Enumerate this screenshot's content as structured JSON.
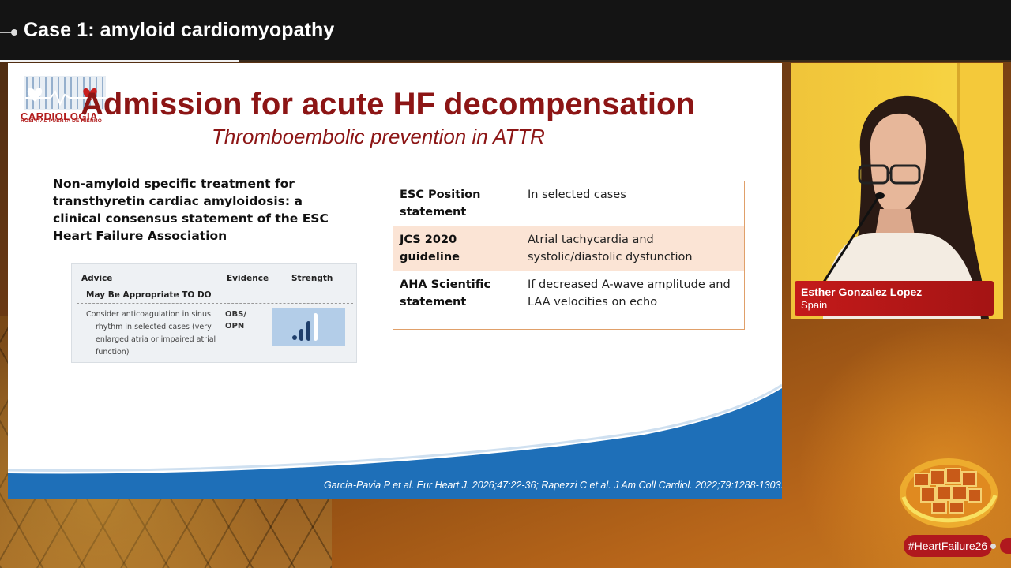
{
  "header": {
    "title": "Case 1: amyloid cardiomyopathy"
  },
  "slide": {
    "logo_text": "CARDIOLOGIA",
    "logo_subtext": "HOSPITAL PUERTA DE HIERRO",
    "title": "Admission for acute HF decompensation",
    "subtitle": "Thromboembolic prevention in ATTR",
    "consensus_heading": "Non-amyloid specific treatment for transthyretin cardiac amyloidosis: a clinical consensus statement of the ESC Heart Failure Association",
    "advice_table": {
      "col_advice": "Advice",
      "col_evidence": "Evidence",
      "col_strength": "Strength",
      "section": "May Be Appropriate TO DO",
      "advice_line1": "Consider anticoagulation in sinus",
      "advice_line2": "rhythm in selected cases (very",
      "advice_line3": "enlarged atria or impaired atrial",
      "advice_line4": "function)",
      "evidence_line1": "OBS/",
      "evidence_line2": "OPN",
      "strength_icon": "signal-bars-icon"
    },
    "comparison_table": [
      {
        "source": "ESC Position statement",
        "recommendation": "In selected cases"
      },
      {
        "source": "JCS 2020 guideline",
        "recommendation": "Atrial tachycardia and systolic/diastolic dysfunction"
      },
      {
        "source": "AHA Scientific statement",
        "recommendation": "If decreased A-wave amplitude and LAA velocities on echo"
      }
    ],
    "citation": "Garcia-Pavia P et al. Eur Heart J. 2026;47:22-36;  Rapezzi C et al. J Am Coll Cardiol. 2022;79:1288-1303.",
    "accent_color": "#8c1515",
    "wave_color": "#1e6fb8"
  },
  "speaker": {
    "name": "Esther Gonzalez Lopez",
    "country": "Spain"
  },
  "footer": {
    "hashtag": "#HeartFailure26"
  }
}
